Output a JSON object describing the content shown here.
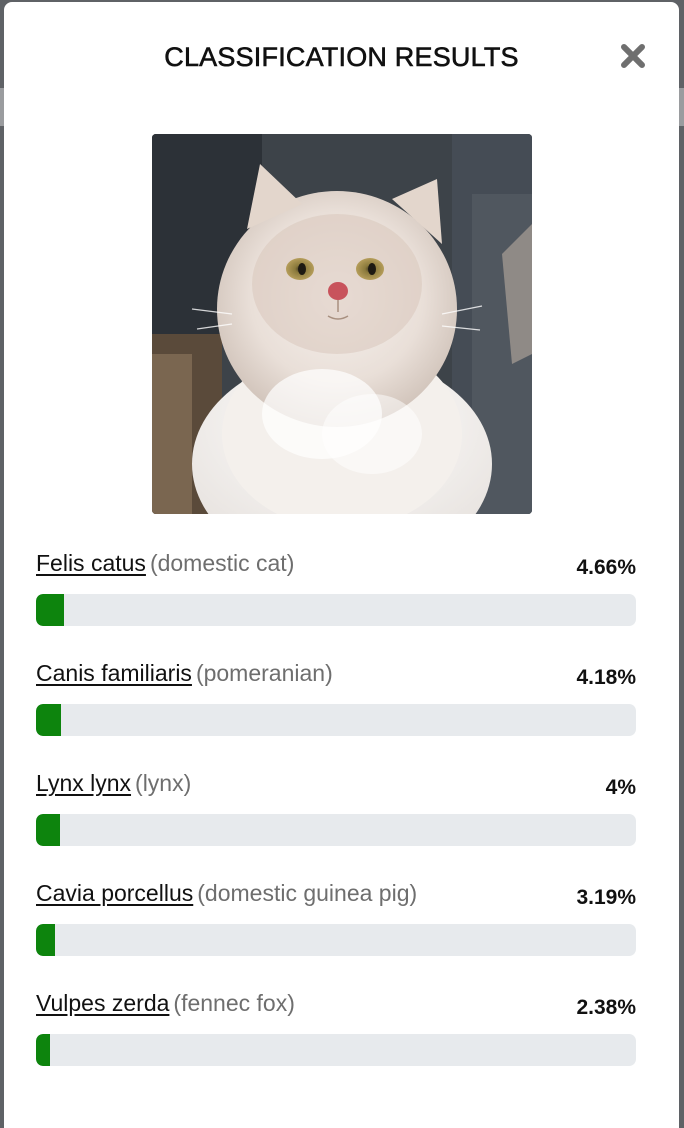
{
  "modal": {
    "title": "CLASSIFICATION RESULTS",
    "close_icon": "close-icon",
    "image_alt": "photo of a fluffy cream-colored kitten"
  },
  "colors": {
    "accent_bar": "#0d840d",
    "track": "#e7eaed"
  },
  "results": [
    {
      "scientific_name": "Felis catus",
      "common_name": "(domestic cat)",
      "percent_label": "4.66%",
      "percent": 4.66
    },
    {
      "scientific_name": "Canis familiaris",
      "common_name": "(pomeranian)",
      "percent_label": "4.18%",
      "percent": 4.18
    },
    {
      "scientific_name": "Lynx lynx",
      "common_name": "(lynx)",
      "percent_label": "4%",
      "percent": 4.0
    },
    {
      "scientific_name": "Cavia porcellus",
      "common_name": "(domestic guinea pig)",
      "percent_label": "3.19%",
      "percent": 3.19
    },
    {
      "scientific_name": "Vulpes zerda",
      "common_name": "(fennec fox)",
      "percent_label": "2.38%",
      "percent": 2.38
    }
  ]
}
